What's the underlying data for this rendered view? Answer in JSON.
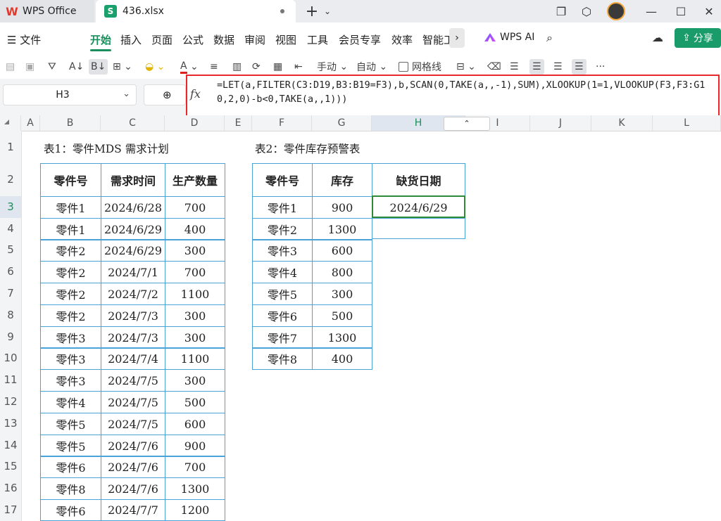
{
  "titlebar": {
    "home_tab": "WPS Office",
    "file_tab": "436.xlsx"
  },
  "menu": {
    "file": "文件",
    "items": [
      "开始",
      "插入",
      "页面",
      "公式",
      "数据",
      "审阅",
      "视图",
      "工具",
      "会员专享",
      "效率",
      "智能工"
    ],
    "wps_ai": "WPS AI",
    "share": "分享"
  },
  "toolbar": {
    "manual": "手动",
    "auto": "自动",
    "gridlines": "网格线"
  },
  "formula_bar": {
    "name_box": "H3",
    "fx": "fx",
    "formula": "=LET(a,FILTER(C3:D19,B3:B19=F3),b,SCAN(0,TAKE(a,,-1),SUM),XLOOKUP(1=1,VLOOKUP(F3,F3:G10,2,0)-b<0,TAKE(a,,1)))"
  },
  "columns": [
    "A",
    "B",
    "C",
    "D",
    "E",
    "F",
    "G",
    "H",
    "I",
    "J",
    "K",
    "L"
  ],
  "rows": [
    "1",
    "2",
    "3",
    "4",
    "5",
    "6",
    "7",
    "8",
    "9",
    "10",
    "11",
    "12",
    "13",
    "14",
    "15",
    "16",
    "17"
  ],
  "table1": {
    "title": "表1：零件MDS 需求计划",
    "headers": [
      "零件号",
      "需求时间",
      "生产数量"
    ],
    "rows": [
      [
        "零件1",
        "2024/6/28",
        "700"
      ],
      [
        "零件1",
        "2024/6/29",
        "400"
      ],
      [
        "零件2",
        "2024/6/29",
        "300"
      ],
      [
        "零件2",
        "2024/7/1",
        "700"
      ],
      [
        "零件2",
        "2024/7/2",
        "1100"
      ],
      [
        "零件2",
        "2024/7/3",
        "300"
      ],
      [
        "零件3",
        "2024/7/3",
        "300"
      ],
      [
        "零件3",
        "2024/7/4",
        "1100"
      ],
      [
        "零件3",
        "2024/7/5",
        "300"
      ],
      [
        "零件4",
        "2024/7/5",
        "500"
      ],
      [
        "零件5",
        "2024/7/5",
        "600"
      ],
      [
        "零件5",
        "2024/7/6",
        "900"
      ],
      [
        "零件6",
        "2024/7/6",
        "700"
      ],
      [
        "零件8",
        "2024/7/6",
        "1300"
      ],
      [
        "零件6",
        "2024/7/7",
        "1200"
      ]
    ]
  },
  "table2": {
    "title": "表2：零件库存预警表",
    "headers": [
      "零件号",
      "库存"
    ],
    "rows": [
      [
        "零件1",
        "900"
      ],
      [
        "零件2",
        "1300"
      ],
      [
        "零件3",
        "600"
      ],
      [
        "零件4",
        "800"
      ],
      [
        "零件5",
        "300"
      ],
      [
        "零件6",
        "500"
      ],
      [
        "零件7",
        "1300"
      ],
      [
        "零件8",
        "400"
      ]
    ]
  },
  "table3": {
    "header": "缺货日期",
    "values": [
      "2024/6/29",
      ""
    ]
  },
  "colors": {
    "accent": "#1a8f5c",
    "table_border": "#4aa3d6",
    "highlight_border": "#e8282b",
    "selection": "#2e8b3a"
  }
}
